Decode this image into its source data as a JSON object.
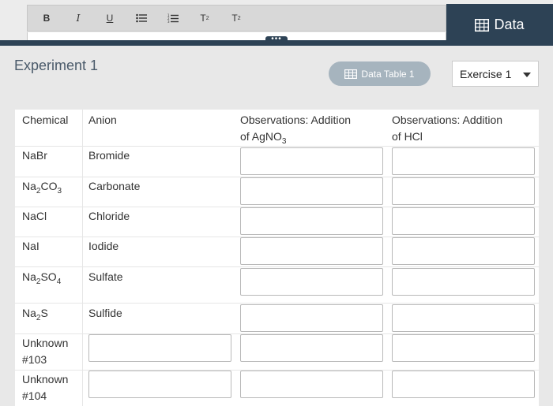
{
  "toolbar": {
    "bold": "B",
    "italic": "I",
    "underline": "U",
    "bullets_icon": "bulleted-list-icon",
    "numbered_icon": "numbered-list-icon",
    "superscript": "T",
    "subscript": "T",
    "data_tab_label": "Data",
    "grip": "•••"
  },
  "header": {
    "title": "Experiment 1",
    "data_table_label": "Data Table 1",
    "exercise_selected": "Exercise 1"
  },
  "table": {
    "headers": {
      "chemical": "Chemical",
      "anion": "Anion",
      "obs_agno3_line1": "Observations: Addition",
      "obs_agno3_line2": "of AgNO",
      "obs_agno3_sub": "3",
      "obs_hcl_line1": "Observations: Addition",
      "obs_hcl_line2": "of HCl"
    },
    "rows": [
      {
        "chem": "NaBr",
        "chem_sub": "",
        "chem_tail": "",
        "anion": "Bromide"
      },
      {
        "chem": "Na",
        "chem_sub": "2",
        "chem_tail": "CO",
        "chem_sub2": "3",
        "anion": "Carbonate"
      },
      {
        "chem": "NaCl",
        "chem_sub": "",
        "chem_tail": "",
        "anion": "Chloride"
      },
      {
        "chem": "NaI",
        "chem_sub": "",
        "chem_tail": "",
        "anion": "Iodide"
      },
      {
        "chem": "Na",
        "chem_sub": "2",
        "chem_tail": "SO",
        "chem_sub2": "4",
        "anion": "Sulfate"
      },
      {
        "chem": "Na",
        "chem_sub": "2",
        "chem_tail": "S",
        "anion": "Sulfide"
      },
      {
        "chem": "Unknown",
        "chem_line2": "#103"
      },
      {
        "chem": "Unknown",
        "chem_line2": "#104"
      }
    ]
  }
}
